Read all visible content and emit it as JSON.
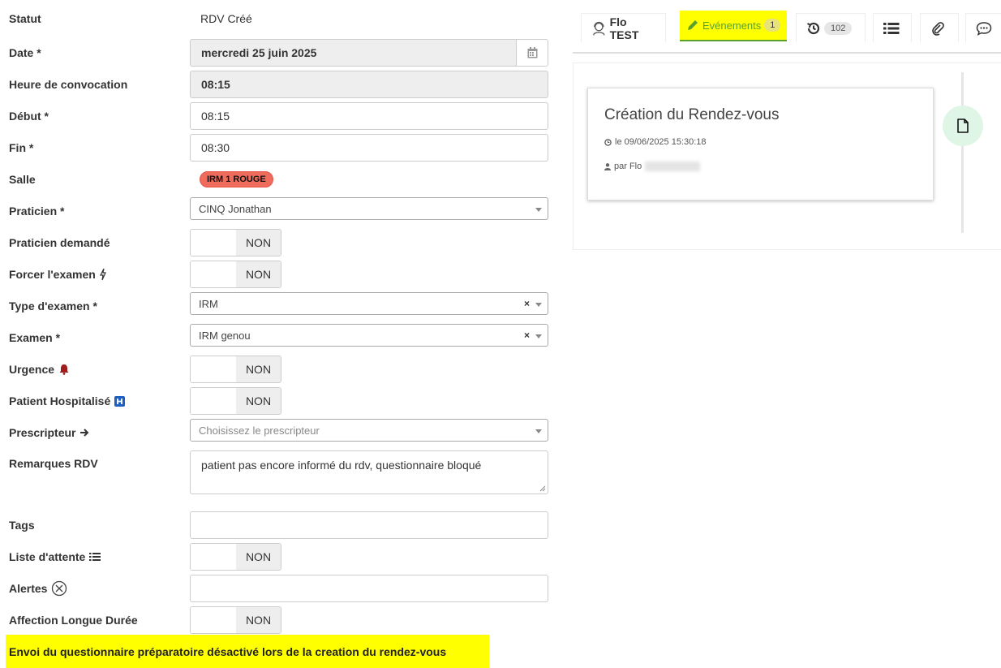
{
  "form": {
    "statut": {
      "label": "Statut",
      "value": "RDV Créé"
    },
    "date": {
      "label": "Date *",
      "value": "mercredi 25 juin 2025"
    },
    "heure_convocation": {
      "label": "Heure de convocation",
      "value": "08:15"
    },
    "debut": {
      "label": "Début *",
      "value": "08:15"
    },
    "fin": {
      "label": "Fin *",
      "value": "08:30"
    },
    "salle": {
      "label": "Salle",
      "value": "IRM 1 ROUGE",
      "color": "#ef6b5c"
    },
    "praticien": {
      "label": "Praticien *",
      "value": "CINQ Jonathan"
    },
    "praticien_demande": {
      "label": "Praticien demandé",
      "value": "NON"
    },
    "forcer_examen": {
      "label": "Forcer l'examen",
      "icon": "bolt-icon",
      "value": "NON"
    },
    "type_examen": {
      "label": "Type d'examen *",
      "value": "IRM",
      "clear": "×"
    },
    "examen": {
      "label": "Examen *",
      "value": "IRM genou",
      "clear": "×"
    },
    "urgence": {
      "label": "Urgence",
      "icon": "bell-icon",
      "value": "NON"
    },
    "patient_hospitalise": {
      "label": "Patient Hospitalisé",
      "icon": "hospital-h-icon",
      "value": "NON"
    },
    "prescripteur": {
      "label": "Prescripteur",
      "icon": "arrow-right-icon",
      "placeholder": "Choisissez le prescripteur"
    },
    "remarques": {
      "label": "Remarques RDV",
      "value": "patient pas encore informé du rdv, questionnaire bloqué"
    },
    "tags": {
      "label": "Tags",
      "value": ""
    },
    "liste_attente": {
      "label": "Liste d'attente",
      "icon": "list-icon",
      "value": "NON"
    },
    "alertes": {
      "label": "Alertes",
      "icon": "circle-x-icon",
      "value": ""
    },
    "ald": {
      "label": "Affection Longue Durée",
      "value": "NON"
    }
  },
  "banner": {
    "text": "Envoi du questionnaire préparatoire désactivé lors de la creation du rendez-vous",
    "color": "#ffff00"
  },
  "tabs": {
    "patient": {
      "label": "Flo TEST",
      "icon": "user-headset-icon"
    },
    "evenements": {
      "label": "Evénements",
      "count": "1",
      "icon": "pencil-icon",
      "color": "#5aa02c"
    },
    "historique": {
      "count": "102",
      "icon": "history-icon"
    },
    "liste": {
      "icon": "list-icon"
    },
    "pieces": {
      "icon": "paperclip-icon"
    },
    "commentaires": {
      "icon": "comment-icon"
    }
  },
  "timeline": {
    "event_title": "Création du Rendez-vous",
    "event_date": "le 09/06/2025 15:30:18",
    "event_author_prefix": "par Flo",
    "icon": "file-icon"
  }
}
